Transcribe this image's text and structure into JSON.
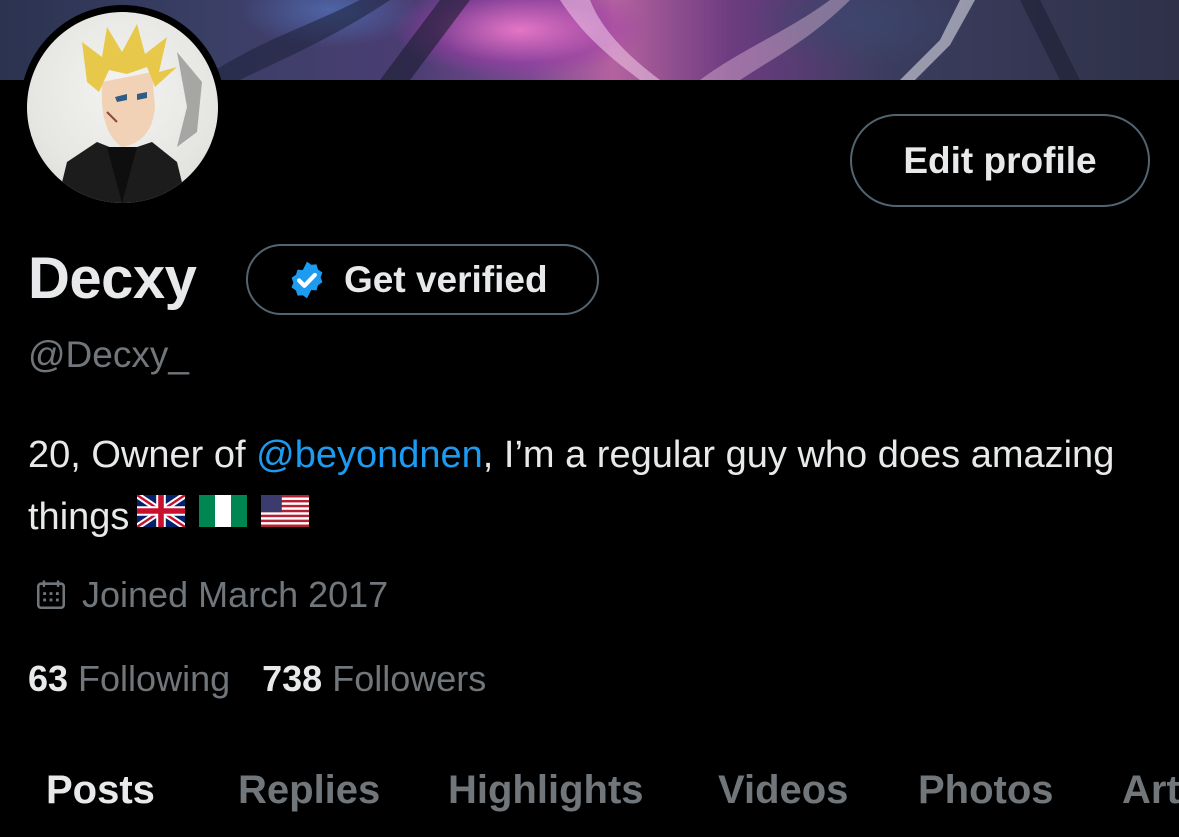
{
  "profile": {
    "display_name": "Decxy",
    "handle": "@Decxy_",
    "edit_profile_label": "Edit profile",
    "get_verified_label": "Get verified",
    "bio_prefix": "20, Owner of ",
    "bio_mention": "@beyondnen",
    "bio_suffix": ", I’m a regular guy who does amazing things",
    "joined": "Joined March 2017",
    "following_count": "63",
    "following_label": "Following",
    "followers_count": "738",
    "followers_label": "Followers"
  },
  "tabs": [
    "Posts",
    "Replies",
    "Highlights",
    "Videos",
    "Photos",
    "Art"
  ],
  "active_tab": "Posts",
  "icons": {
    "verified": "verified-badge-icon",
    "calendar": "calendar-icon",
    "flags": [
      "uk-flag-icon",
      "nigeria-flag-icon",
      "us-flag-icon"
    ]
  },
  "colors": {
    "background": "#000000",
    "text": "#e7e9ea",
    "muted": "#71767b",
    "accent": "#1d9bf0",
    "border": "#536471"
  }
}
